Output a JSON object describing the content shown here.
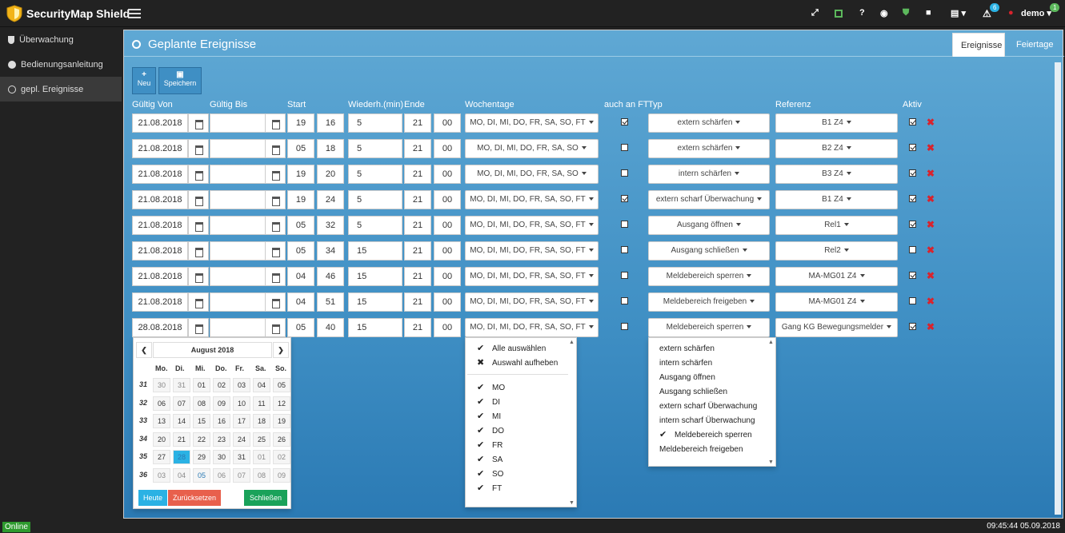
{
  "app": {
    "title": "SecurityMap Shield"
  },
  "topbar": {
    "notif_count": "6",
    "user": "demo",
    "user_badge": "1"
  },
  "sidebar": {
    "items": [
      {
        "label": "Überwachung",
        "icon": "shield-icon"
      },
      {
        "label": "Bedienungsanleitung",
        "icon": "info-icon"
      },
      {
        "label": "gepl. Ereignisse",
        "icon": "clock-icon",
        "active": true
      }
    ]
  },
  "page": {
    "title": "Geplante Ereignisse",
    "tabs": [
      "Ereignisse",
      "Feiertage"
    ]
  },
  "toolbar": {
    "new_label": "Neu",
    "save_label": "Speichern"
  },
  "columns": [
    "Gültig Von",
    "Gültig Bis",
    "Start",
    "Wiederh.(min)",
    "Ende",
    "Wochentage",
    "auch an FT",
    "Typ",
    "Referenz",
    "Aktiv"
  ],
  "rows": [
    {
      "von": "21.08.2018",
      "bis": "",
      "sh": "19",
      "sm": "16",
      "rep": "5",
      "eh": "21",
      "em": "00",
      "days": "MO, DI, MI, DO, FR, SA, SO, FT",
      "ft": true,
      "typ": "extern schärfen",
      "ref": "B1 Z4",
      "aktiv": true
    },
    {
      "von": "21.08.2018",
      "bis": "",
      "sh": "05",
      "sm": "18",
      "rep": "5",
      "eh": "21",
      "em": "00",
      "days": "MO, DI, MI, DO, FR, SA, SO",
      "ft": false,
      "typ": "extern schärfen",
      "ref": "B2 Z4",
      "aktiv": true
    },
    {
      "von": "21.08.2018",
      "bis": "",
      "sh": "19",
      "sm": "20",
      "rep": "5",
      "eh": "21",
      "em": "00",
      "days": "MO, DI, MI, DO, FR, SA, SO",
      "ft": false,
      "typ": "intern schärfen",
      "ref": "B3 Z4",
      "aktiv": true
    },
    {
      "von": "21.08.2018",
      "bis": "",
      "sh": "19",
      "sm": "24",
      "rep": "5",
      "eh": "21",
      "em": "00",
      "days": "MO, DI, MI, DO, FR, SA, SO, FT",
      "ft": true,
      "typ": "extern scharf Überwachung",
      "ref": "B1 Z4",
      "aktiv": true
    },
    {
      "von": "21.08.2018",
      "bis": "",
      "sh": "05",
      "sm": "32",
      "rep": "5",
      "eh": "21",
      "em": "00",
      "days": "MO, DI, MI, DO, FR, SA, SO, FT",
      "ft": false,
      "typ": "Ausgang öffnen",
      "ref": "Rel1",
      "aktiv": true
    },
    {
      "von": "21.08.2018",
      "bis": "",
      "sh": "05",
      "sm": "34",
      "rep": "15",
      "eh": "21",
      "em": "00",
      "days": "MO, DI, MI, DO, FR, SA, SO, FT",
      "ft": false,
      "typ": "Ausgang schließen",
      "ref": "Rel2",
      "aktiv": false
    },
    {
      "von": "21.08.2018",
      "bis": "",
      "sh": "04",
      "sm": "46",
      "rep": "15",
      "eh": "21",
      "em": "00",
      "days": "MO, DI, MI, DO, FR, SA, SO, FT",
      "ft": false,
      "typ": "Meldebereich sperren",
      "ref": "MA-MG01 Z4",
      "aktiv": true
    },
    {
      "von": "21.08.2018",
      "bis": "",
      "sh": "04",
      "sm": "51",
      "rep": "15",
      "eh": "21",
      "em": "00",
      "days": "MO, DI, MI, DO, FR, SA, SO, FT",
      "ft": false,
      "typ": "Meldebereich freigeben",
      "ref": "MA-MG01 Z4",
      "aktiv": false
    },
    {
      "von": "28.08.2018",
      "bis": "",
      "sh": "05",
      "sm": "40",
      "rep": "15",
      "eh": "21",
      "em": "00",
      "days": "MO, DI, MI, DO, FR, SA, SO, FT",
      "ft": false,
      "typ": "Meldebereich sperren",
      "ref": "Gang KG Bewegungsmelder",
      "aktiv": true
    }
  ],
  "calendar": {
    "month": "August 2018",
    "weekdays": [
      "Mo.",
      "Di.",
      "Mi.",
      "Do.",
      "Fr.",
      "Sa.",
      "So."
    ],
    "weeks": [
      {
        "wk": "31",
        "days": [
          "30",
          "31",
          "01",
          "02",
          "03",
          "04",
          "05"
        ]
      },
      {
        "wk": "32",
        "days": [
          "06",
          "07",
          "08",
          "09",
          "10",
          "11",
          "12"
        ]
      },
      {
        "wk": "33",
        "days": [
          "13",
          "14",
          "15",
          "16",
          "17",
          "18",
          "19"
        ]
      },
      {
        "wk": "34",
        "days": [
          "20",
          "21",
          "22",
          "23",
          "24",
          "25",
          "26"
        ]
      },
      {
        "wk": "35",
        "days": [
          "27",
          "28",
          "29",
          "30",
          "31",
          "01",
          "02"
        ]
      },
      {
        "wk": "36",
        "days": [
          "03",
          "04",
          "05",
          "06",
          "07",
          "08",
          "09"
        ]
      }
    ],
    "selected": "28",
    "today_btn": "Heute",
    "reset_btn": "Zurücksetzen",
    "close_btn": "Schließen"
  },
  "weekday_menu": {
    "select_all": "Alle auswählen",
    "deselect": "Auswahl aufheben",
    "items": [
      "MO",
      "DI",
      "MI",
      "DO",
      "FR",
      "SA",
      "SO",
      "FT"
    ]
  },
  "type_menu": {
    "items": [
      "extern schärfen",
      "intern schärfen",
      "Ausgang öffnen",
      "Ausgang schließen",
      "extern scharf Überwachung",
      "intern scharf Überwachung",
      "Meldebereich sperren",
      "Meldebereich freigeben"
    ],
    "selected": "Meldebereich sperren"
  },
  "status": {
    "connection": "Online",
    "clock": "09:45:44 05.09.2018"
  },
  "colors": {
    "accent": "#3f8fc4",
    "online": "#2e9a2e",
    "danger": "#d9232d",
    "today": "#2bb2e4",
    "reset": "#e8604c",
    "close": "#1aa25a"
  }
}
